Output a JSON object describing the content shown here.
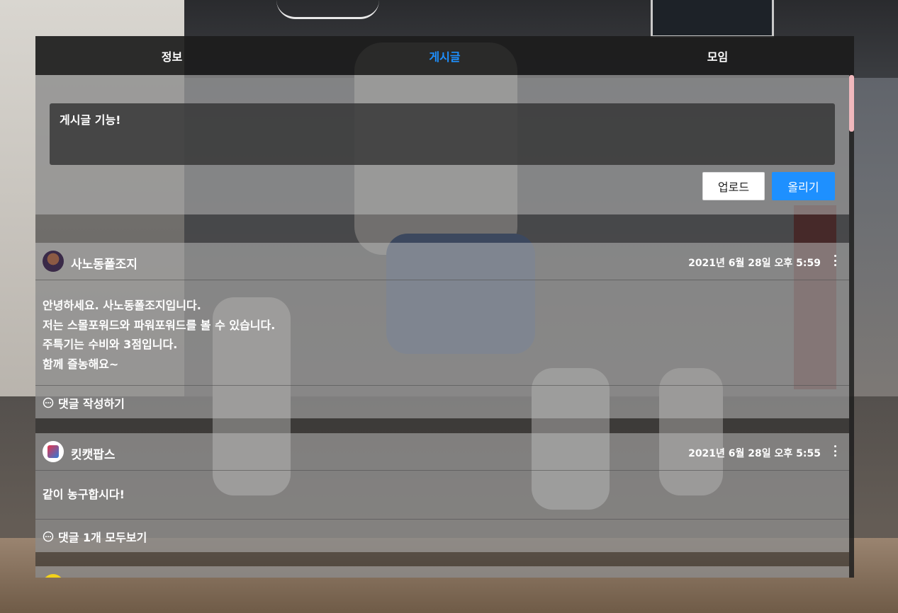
{
  "tabs": [
    {
      "label": "정보"
    },
    {
      "label": "게시글"
    },
    {
      "label": "모임"
    }
  ],
  "active_tab": "게시글",
  "composer": {
    "text": "게시글 기능!",
    "upload_label": "업로드",
    "post_label": "올리기"
  },
  "posts": [
    {
      "author": "사노동폴조지",
      "timestamp": "2021년 6월 28일 오후 5:59",
      "body": [
        "안녕하세요. 사노동폴조지입니다.",
        "저는 스몰포워드와 파워포워드를 볼 수 있습니다.",
        "주특기는 수비와 3점입니다.",
        "함께 즐농해요~"
      ],
      "comment_action": "댓글 작성하기"
    },
    {
      "author": "킷캣팝스",
      "timestamp": "2021년 6월 28일 오후 5:55",
      "body": [
        "같이 농구합시다!"
      ],
      "comment_action": "댓글 1개 모두보기"
    }
  ],
  "colors": {
    "accent": "#1e90ff",
    "tab_bar": "#1c1c1c",
    "scrollbar_thumb": "#f0b8bd"
  },
  "icons": {
    "more": "vertical-dots-icon",
    "comment": "speech-bubble-icon"
  }
}
